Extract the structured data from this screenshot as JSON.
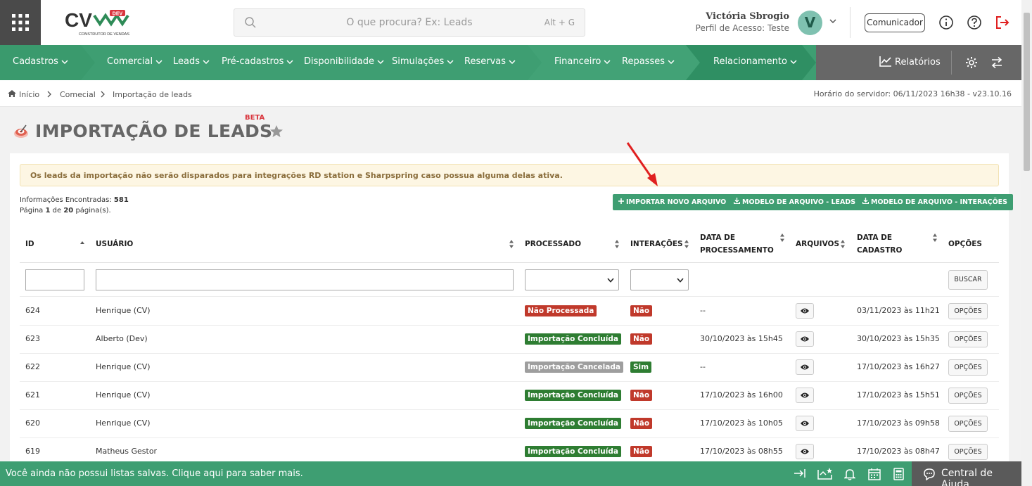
{
  "header": {
    "logo_text": "CV",
    "logo_badge": "DEV",
    "logo_tagline": "CONSTRUTOR DE VENDAS",
    "search_placeholder": "O que procura? Ex: Leads",
    "search_shortcut": "Alt + G",
    "user_name": "Victória Sbrogio",
    "user_profile": "Perfil de Acesso: Teste",
    "avatar_initial": "V",
    "communicator_label": "Comunicador"
  },
  "nav": {
    "items": [
      {
        "label": "Cadastros"
      },
      {
        "label": "Comercial"
      },
      {
        "label": "Leads"
      },
      {
        "label": "Pré-cadastros"
      },
      {
        "label": "Disponibilidade"
      },
      {
        "label": "Simulações"
      },
      {
        "label": "Reservas"
      },
      {
        "label": "Financeiro"
      },
      {
        "label": "Repasses"
      },
      {
        "label": "Relacionamento"
      }
    ],
    "reports_label": "Relatórios"
  },
  "breadcrumb": {
    "items": [
      "Início",
      "Comecial",
      "Importação de leads"
    ],
    "server_time": "Horário do servidor: 06/11/2023 16h38 - v23.10.16"
  },
  "page": {
    "title": "IMPORTAÇÃO DE LEADS",
    "beta": "BETA",
    "alert": "Os leads da importação não serão disparados para integrações RD station e Sharpspring caso possua alguma delas ativa.",
    "found_label": "Informações Encontradas:",
    "found_count": "581",
    "page_label_prefix": "Página",
    "page_current": "1",
    "page_of": "de",
    "page_total": "20",
    "page_suffix": "página(s).",
    "btn_import": "IMPORTAR NOVO ARQUIVO",
    "btn_model_leads": "MODELO DE ARQUIVO - LEADS",
    "btn_model_interactions": "MODELO DE ARQUIVO - INTERAÇÕES"
  },
  "table": {
    "headers": {
      "id": "ID",
      "user": "USUÁRIO",
      "processed": "PROCESSADO",
      "interactions": "INTERAÇÕES",
      "processing_date_1": "DATA DE",
      "processing_date_2": "PROCESSAMENTO",
      "files": "ARQUIVOS",
      "register_date_1": "DATA DE",
      "register_date_2": "CADASTRO",
      "options": "OPÇÕES"
    },
    "search_button": "BUSCAR",
    "options_button": "OPÇÕES",
    "rows": [
      {
        "id": "624",
        "user": "Henrique (CV)",
        "status": "Não Processada",
        "status_color": "#c0392b",
        "inter": "Não",
        "inter_color": "#c0392b",
        "proc_date": "--",
        "reg_date": "03/11/2023 às 11h21"
      },
      {
        "id": "623",
        "user": "Alberto (Dev)",
        "status": "Importação Concluída",
        "status_color": "#2e7d32",
        "inter": "Não",
        "inter_color": "#c0392b",
        "proc_date": "30/10/2023 às 15h45",
        "reg_date": "30/10/2023 às 15h35"
      },
      {
        "id": "622",
        "user": "Henrique (CV)",
        "status": "Importação Cancelada",
        "status_color": "#9e9e9e",
        "inter": "Sim",
        "inter_color": "#2e7d32",
        "proc_date": "--",
        "reg_date": "17/10/2023 às 16h27"
      },
      {
        "id": "621",
        "user": "Henrique (CV)",
        "status": "Importação Concluída",
        "status_color": "#2e7d32",
        "inter": "Não",
        "inter_color": "#c0392b",
        "proc_date": "17/10/2023 às 16h00",
        "reg_date": "17/10/2023 às 15h51"
      },
      {
        "id": "620",
        "user": "Henrique (CV)",
        "status": "Importação Concluída",
        "status_color": "#2e7d32",
        "inter": "Não",
        "inter_color": "#c0392b",
        "proc_date": "17/10/2023 às 10h05",
        "reg_date": "17/10/2023 às 09h58"
      },
      {
        "id": "619",
        "user": "Matheus Gestor",
        "status": "Importação Concluída",
        "status_color": "#2e7d32",
        "inter": "Não",
        "inter_color": "#c0392b",
        "proc_date": "17/10/2023 às 08h55",
        "reg_date": "17/10/2023 às 08h47"
      }
    ]
  },
  "footer": {
    "message": "Você ainda não possui listas salvas. Clique aqui para saber mais.",
    "help": "Central de Ajuda"
  },
  "colors": {
    "brand_green": "#3e9e72",
    "nav_gray": "#676767",
    "annotation_arrow": "#e02020"
  },
  "icons": [
    "apps-grid-icon",
    "search-icon",
    "chevron-down-icon",
    "info-icon",
    "help-icon",
    "logout-icon",
    "chart-icon",
    "gear-icon",
    "swap-icon",
    "home-icon",
    "target-icon",
    "star-icon",
    "plus-icon",
    "download-icon",
    "sort-icon",
    "eye-icon",
    "collapse-icon",
    "list-star-icon",
    "bell-icon",
    "calendar-icon",
    "calculator-icon",
    "chat-icon"
  ]
}
